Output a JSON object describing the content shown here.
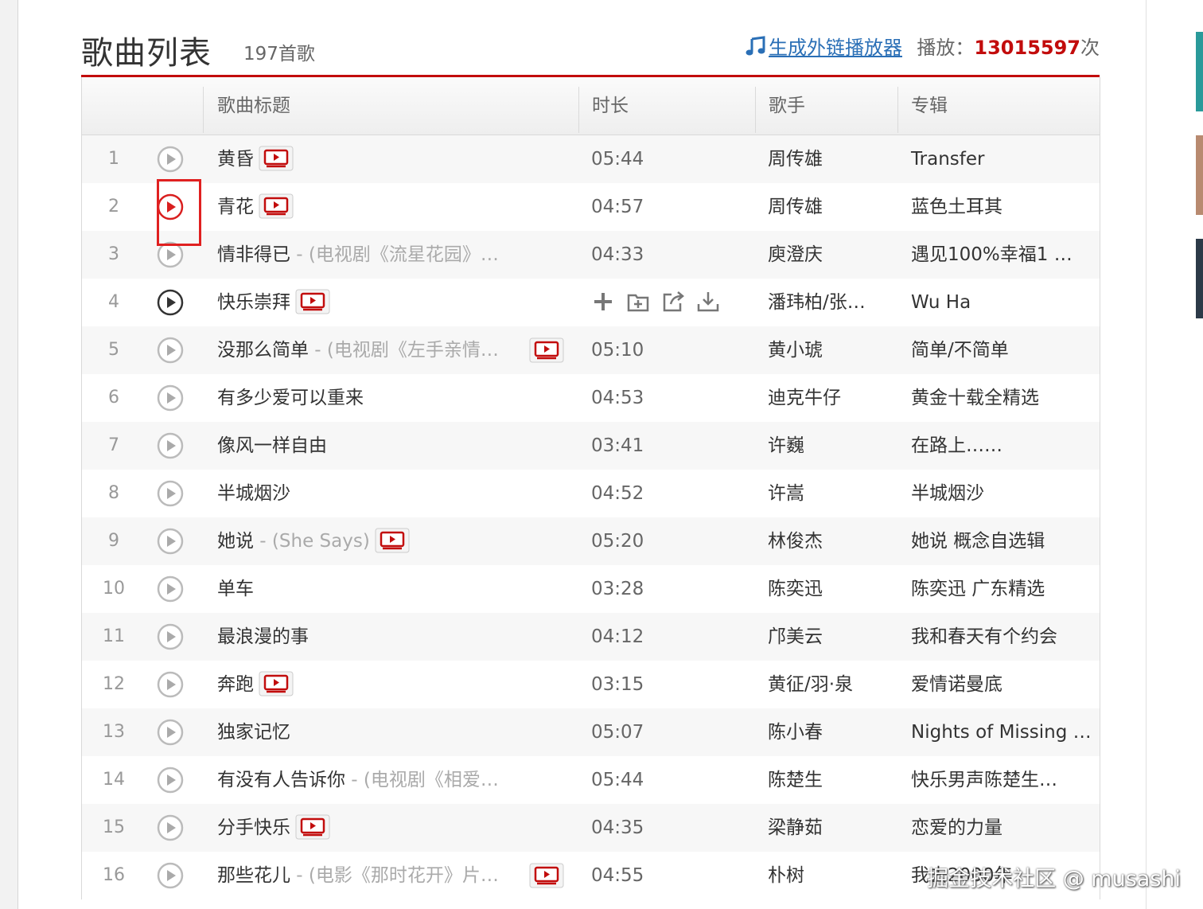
{
  "header": {
    "title": "歌曲列表",
    "count": "197首歌",
    "outchain_label": "生成外链播放器",
    "play_label": "播放：",
    "play_count": "13015597",
    "play_suffix": "次"
  },
  "columns": [
    "歌曲标题",
    "时长",
    "歌手",
    "专辑"
  ],
  "songs": [
    {
      "num": "1",
      "title": "黄昏",
      "alias": "",
      "duration": "05:44",
      "artist": "周传雄",
      "album": "Transfer",
      "mv": true,
      "play_state": "normal"
    },
    {
      "num": "2",
      "title": "青花",
      "alias": "",
      "duration": "04:57",
      "artist": "周传雄",
      "album": "蓝色土耳其",
      "mv": true,
      "play_state": "active"
    },
    {
      "num": "3",
      "title": "情非得已",
      "alias": " - (电视剧《流星花园》…",
      "duration": "04:33",
      "artist": "庾澄庆",
      "album": "遇见100%幸福1 …",
      "mv": false,
      "play_state": "normal"
    },
    {
      "num": "4",
      "title": "快乐崇拜",
      "alias": "",
      "duration": "",
      "artist": "潘玮柏/张…",
      "album": "Wu Ha",
      "mv": true,
      "play_state": "hover",
      "hovered": true
    },
    {
      "num": "5",
      "title": "没那么简单",
      "alias": " - (电视剧《左手亲情…",
      "duration": "05:10",
      "artist": "黄小琥",
      "album": "简单/不简单",
      "mv": true,
      "mv_at_end": true,
      "play_state": "normal"
    },
    {
      "num": "6",
      "title": "有多少爱可以重来",
      "alias": "",
      "duration": "04:53",
      "artist": "迪克牛仔",
      "album": "黄金十载全精选",
      "mv": false,
      "play_state": "normal"
    },
    {
      "num": "7",
      "title": "像风一样自由",
      "alias": "",
      "duration": "03:41",
      "artist": "许巍",
      "album": "在路上……",
      "mv": false,
      "play_state": "normal"
    },
    {
      "num": "8",
      "title": "半城烟沙",
      "alias": "",
      "duration": "04:52",
      "artist": "许嵩",
      "album": "半城烟沙",
      "mv": false,
      "play_state": "normal"
    },
    {
      "num": "9",
      "title": "她说",
      "alias": " - (She Says)",
      "duration": "05:20",
      "artist": "林俊杰",
      "album": "她说 概念自选辑",
      "mv": true,
      "play_state": "normal"
    },
    {
      "num": "10",
      "title": "单车",
      "alias": "",
      "duration": "03:28",
      "artist": "陈奕迅",
      "album": "陈奕迅 广东精选",
      "mv": false,
      "play_state": "normal"
    },
    {
      "num": "11",
      "title": "最浪漫的事",
      "alias": "",
      "duration": "04:12",
      "artist": "邝美云",
      "album": "我和春天有个约会",
      "mv": false,
      "play_state": "normal"
    },
    {
      "num": "12",
      "title": "奔跑",
      "alias": "",
      "duration": "03:15",
      "artist": "黄征/羽·泉",
      "album": "爱情诺曼底",
      "mv": true,
      "play_state": "normal"
    },
    {
      "num": "13",
      "title": "独家记忆",
      "alias": "",
      "duration": "05:07",
      "artist": "陈小春",
      "album": "Nights of Missing …",
      "mv": false,
      "play_state": "normal"
    },
    {
      "num": "14",
      "title": "有没有人告诉你",
      "alias": " - (电视剧《相爱…",
      "duration": "05:44",
      "artist": "陈楚生",
      "album": "快乐男声陈楚生…",
      "mv": false,
      "play_state": "normal"
    },
    {
      "num": "15",
      "title": "分手快乐",
      "alias": "",
      "duration": "04:35",
      "artist": "梁静茹",
      "album": "恋爱的力量",
      "mv": true,
      "play_state": "normal"
    },
    {
      "num": "16",
      "title": "那些花儿",
      "alias": " - (电影《那时花开》片…",
      "duration": "04:55",
      "artist": "朴树",
      "album": "我去2000年",
      "mv": true,
      "mv_at_end": true,
      "play_state": "normal"
    }
  ],
  "row_ops": [
    "add-icon",
    "add-to-folder-icon",
    "share-icon",
    "download-icon"
  ],
  "watermark": "掘金技术社区 @ musashi",
  "colors": {
    "accent_red": "#c20c0c",
    "link_blue": "#2a6fb6",
    "highlight_box": "#e02020"
  }
}
